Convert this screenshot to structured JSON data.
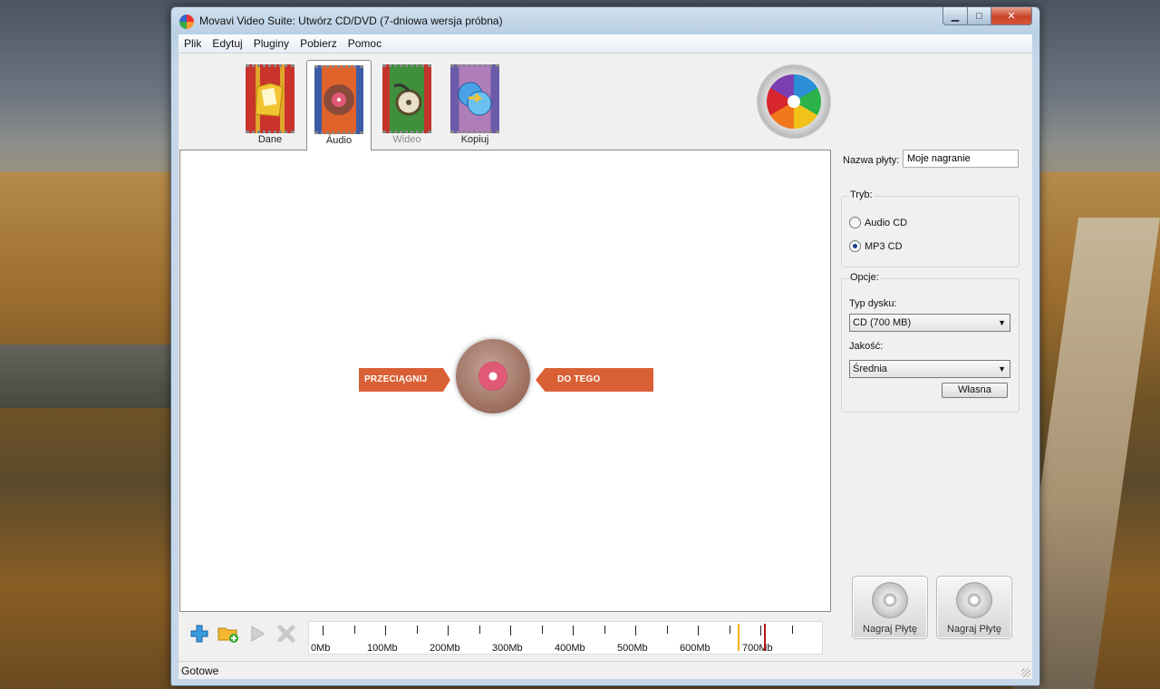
{
  "window": {
    "title": "Movavi Video Suite: Utwórz CD/DVD (7-dniowa wersja próbna)"
  },
  "menu": [
    "Plik",
    "Edytuj",
    "Pluginy",
    "Pobierz",
    "Pomoc"
  ],
  "tabs": [
    {
      "label": "Dane",
      "icon": "folder-documents-icon",
      "active": false
    },
    {
      "label": "Áudio",
      "icon": "music-disc-icon",
      "active": true
    },
    {
      "label": "Wideo",
      "icon": "film-reel-icon",
      "active": false
    },
    {
      "label": "Kopiuj",
      "icon": "disc-copy-icon",
      "active": false
    }
  ],
  "drop": {
    "left_text": "PRZECIĄGNIJ PLIKI",
    "right_text": "DO TEGO OBSZARU"
  },
  "disc_name": {
    "label": "Nazwa płyty:",
    "value": "Moje nagranie"
  },
  "mode": {
    "title": "Tryb:",
    "options": [
      {
        "label": "Audio CD",
        "selected": false
      },
      {
        "label": "MP3 CD",
        "selected": true
      }
    ]
  },
  "options": {
    "title": "Opcje:",
    "disk_type_label": "Typ dysku:",
    "disk_type_value": "CD (700 MB)",
    "quality_label": "Jakość:",
    "quality_value": "Średnia",
    "custom_button": "Własna"
  },
  "burn_buttons": [
    "Nagraj Płytę",
    "Nagraj Płytę"
  ],
  "ruler": {
    "labels": [
      "0Mb",
      "100Mb",
      "200Mb",
      "300Mb",
      "400Mb",
      "500Mb",
      "600Mb",
      "700Mb"
    ],
    "max_mb": 760,
    "marker_yellow_mb": 664,
    "marker_red_mb": 706
  },
  "status": "Gotowe",
  "colors": {
    "drop_accent": "#d96035",
    "marker_yellow": "#f0b400",
    "marker_red": "#b01818"
  }
}
